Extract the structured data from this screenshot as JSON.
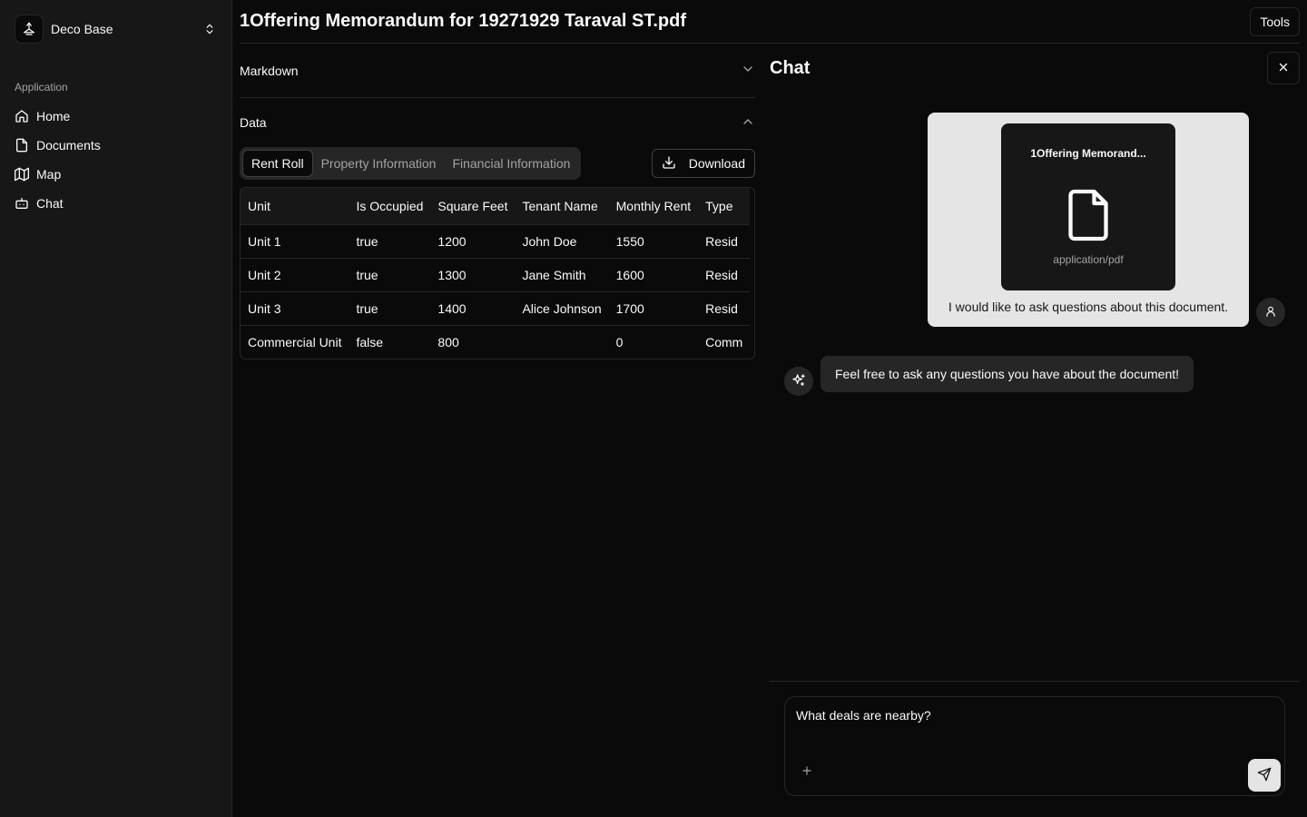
{
  "sidebar": {
    "workspace_name": "Deco Base",
    "group_label": "Application",
    "items": [
      {
        "label": "Home",
        "icon": "home-icon"
      },
      {
        "label": "Documents",
        "icon": "file-icon"
      },
      {
        "label": "Map",
        "icon": "map-icon"
      },
      {
        "label": "Chat",
        "icon": "bot-icon"
      }
    ]
  },
  "header": {
    "title": "1Offering Memorandum for 19271929 Taraval ST.pdf",
    "tools_label": "Tools"
  },
  "sections": {
    "markdown_label": "Markdown",
    "data_label": "Data"
  },
  "tabs": [
    "Rent Roll",
    "Property Information",
    "Financial Information"
  ],
  "active_tab": "Rent Roll",
  "download_label": "Download",
  "table": {
    "headers": [
      "Unit",
      "Is Occupied",
      "Square Feet",
      "Tenant Name",
      "Monthly Rent",
      "Type"
    ],
    "rows": [
      [
        "Unit 1",
        "true",
        "1200",
        "John Doe",
        "1550",
        "Resid"
      ],
      [
        "Unit 2",
        "true",
        "1300",
        "Jane Smith",
        "1600",
        "Resid"
      ],
      [
        "Unit 3",
        "true",
        "1400",
        "Alice Johnson",
        "1700",
        "Resid"
      ],
      [
        "Commercial Unit",
        "false",
        "800",
        "",
        "0",
        "Comm"
      ]
    ]
  },
  "chat": {
    "title": "Chat",
    "attachment": {
      "name": "1Offering Memorand...",
      "type": "application/pdf"
    },
    "user_message": "I would like to ask questions about this document.",
    "assistant_message": "Feel free to ask any questions you have about the document!",
    "input_value": "What deals are nearby?"
  },
  "colors": {
    "background": "#0a0a0a",
    "sidebar": "#171717",
    "border": "#262626",
    "user_bubble": "#e5e5e5"
  }
}
